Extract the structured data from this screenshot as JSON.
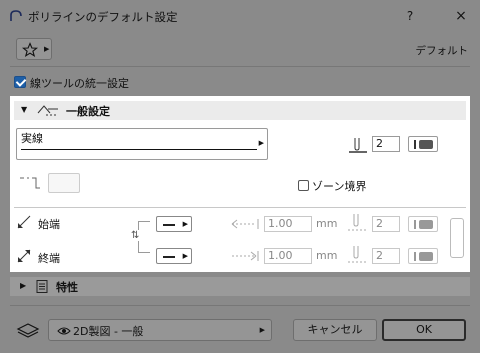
{
  "window": {
    "title": "ポリラインのデフォルト設定",
    "help_label": "?",
    "close_label": "×"
  },
  "favorites": {
    "default_label": "デフォルト"
  },
  "unify": {
    "checked": true,
    "label": "線ツールの統一設定"
  },
  "general": {
    "header": "一般設定",
    "line_type": "実線",
    "line_pen": "2",
    "zone_boundary_label": "ゾーン境界",
    "zone_boundary_checked": false,
    "start": {
      "label": "始端",
      "size": "1.00",
      "unit": "mm",
      "pen": "2"
    },
    "end": {
      "label": "終端",
      "size": "1.00",
      "unit": "mm",
      "pen": "2"
    }
  },
  "properties": {
    "header": "特性"
  },
  "footer": {
    "layer": "2D製図 - 一般",
    "cancel_label": "キャンセル",
    "ok_label": "OK"
  },
  "colors": {
    "dialog_bg": "#8a8a8a",
    "panel_bg": "#ffffff",
    "checkbox_accent": "#1d5fa8"
  }
}
